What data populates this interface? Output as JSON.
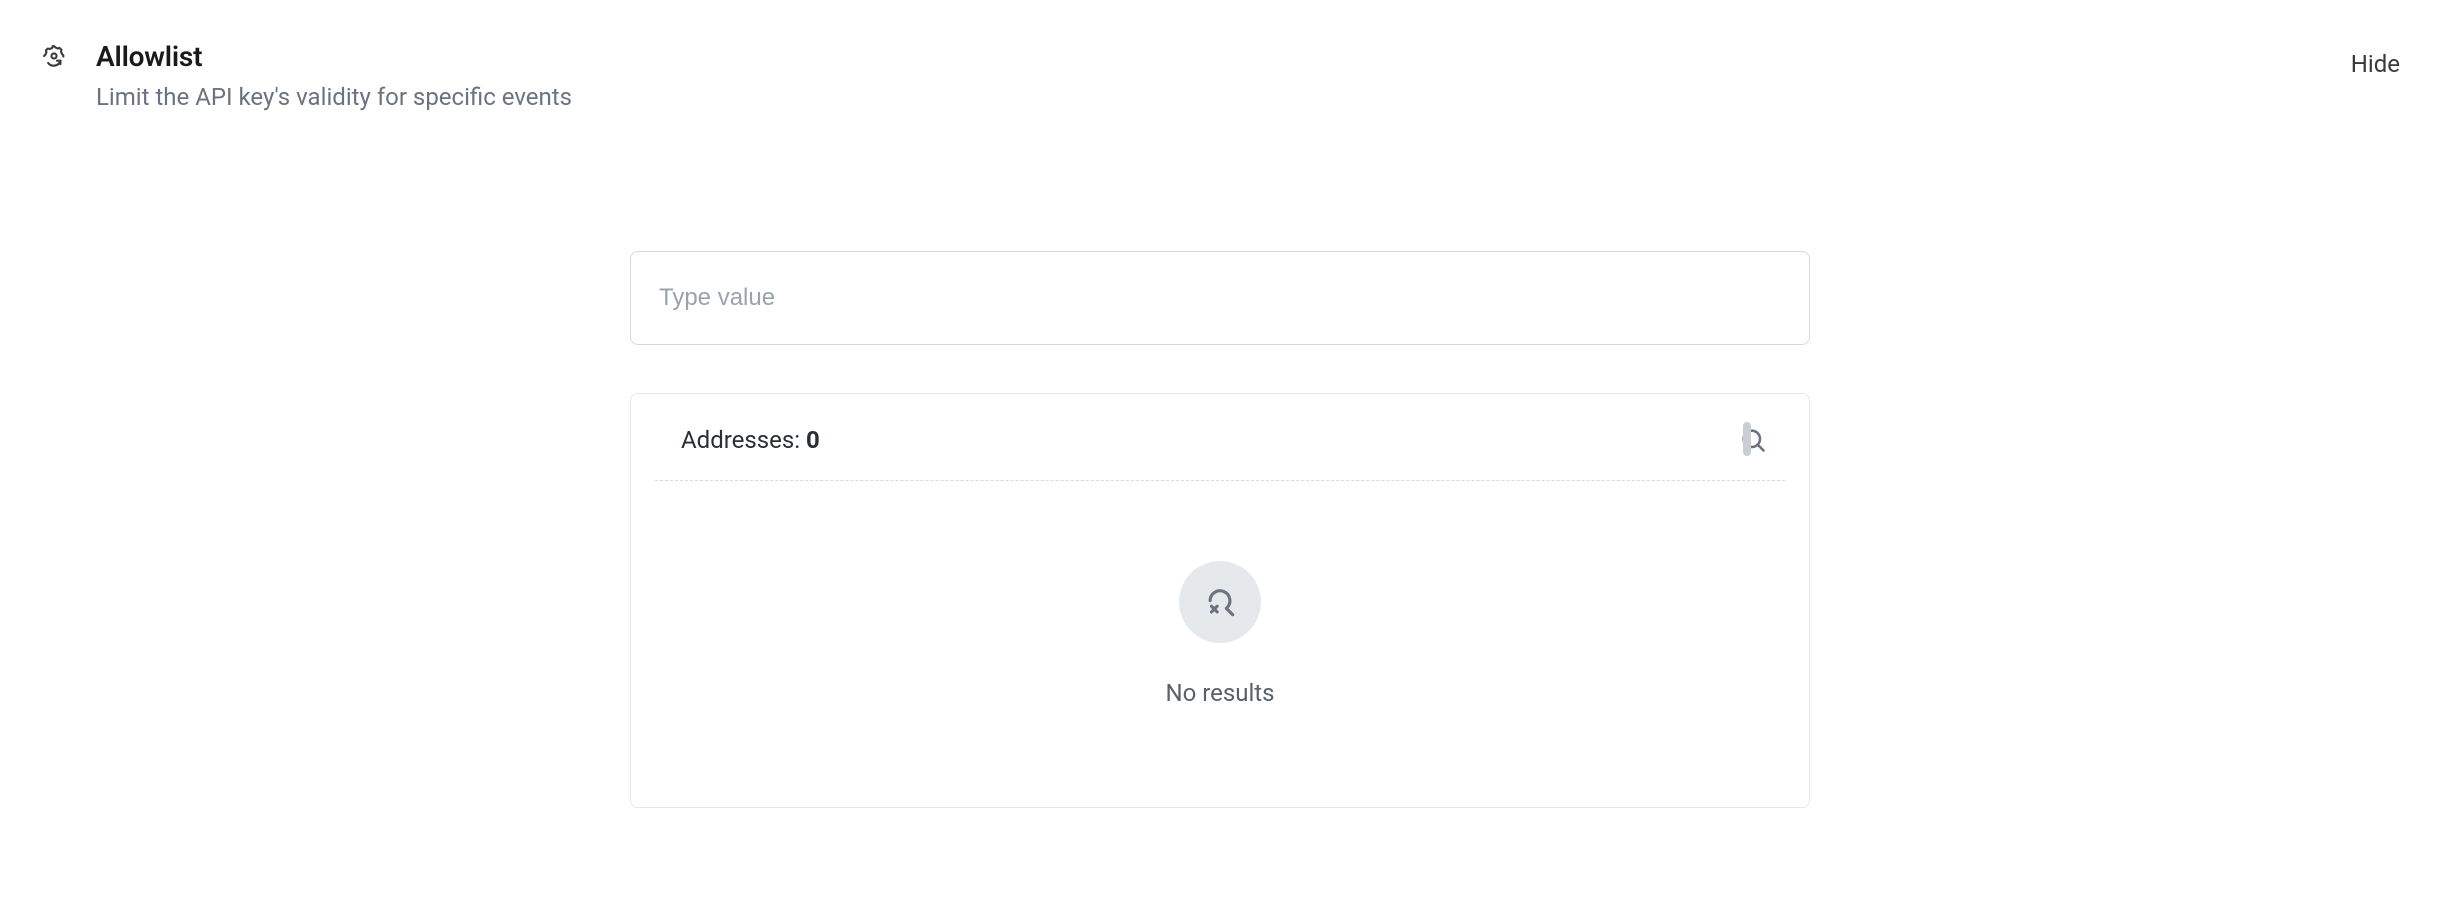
{
  "header": {
    "title": "Allowlist",
    "subtitle": "Limit the API key's validity for specific events",
    "hide_label": "Hide"
  },
  "input": {
    "placeholder": "Type value",
    "value": ""
  },
  "panel": {
    "addresses_label": "Addresses:",
    "addresses_count": "0",
    "empty_text": "No results"
  }
}
